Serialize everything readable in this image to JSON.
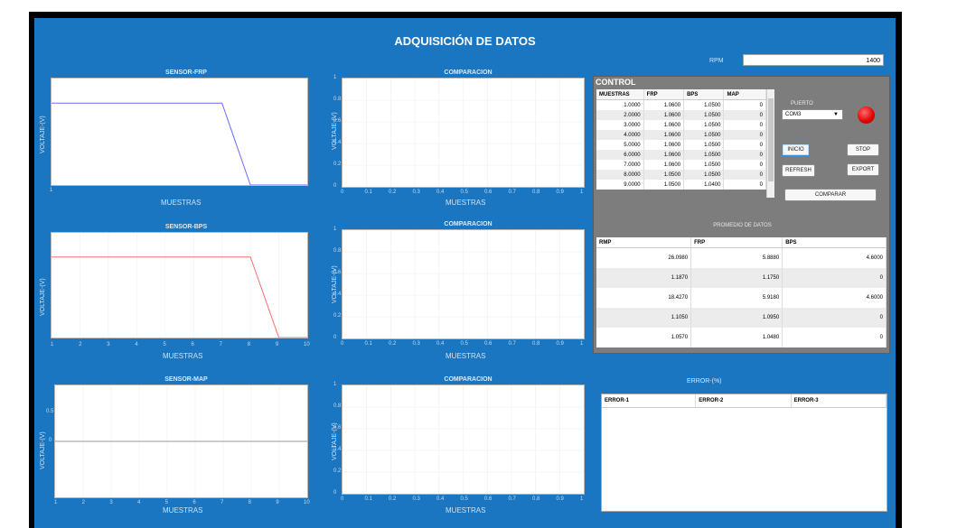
{
  "app": {
    "title": "ADQUISICIÓN DE DATOS",
    "rpm_label": "RPM",
    "rpm_value": "1400"
  },
  "plots": {
    "frp": {
      "title": "SENSOR-FRP",
      "xlabel": "MUESTRAS",
      "ylabel": "VOLTAJE-(V)",
      "xticks": [
        "1"
      ]
    },
    "bps": {
      "title": "SENSOR-BPS",
      "xlabel": "MUESTRAS",
      "ylabel": "VOLTAJE-(V)",
      "xticks": [
        "1",
        "2",
        "3",
        "4",
        "5",
        "6",
        "7",
        "8",
        "9",
        "10"
      ]
    },
    "map": {
      "title": "SENSOR-MAP",
      "xlabel": "MUESTRAS",
      "ylabel": "VOLTAJE-(V)",
      "xticks": [
        "1",
        "2",
        "3",
        "4",
        "5",
        "6",
        "7",
        "8",
        "9",
        "10"
      ],
      "yticks": [
        "0.5",
        "0"
      ]
    },
    "cmp1": {
      "title": "COMPARACION",
      "xlabel": "MUESTRAS",
      "ylabel": "VOLTAJE-(V)"
    },
    "cmp2": {
      "title": "COMPARACION",
      "xlabel": "MUESTRAS",
      "ylabel": "VOLTAJE-(V)"
    },
    "cmp3": {
      "title": "COMPARACION",
      "xlabel": "MUESTRAS",
      "ylabel": "VOLTAJE-(V)"
    },
    "cmp_xticks": [
      "0",
      "0.1",
      "0.2",
      "0.3",
      "0.4",
      "0.5",
      "0.6",
      "0.7",
      "0.8",
      "0.9",
      "1"
    ],
    "cmp_yticks": [
      "1",
      "0.8",
      "0.6",
      "0.4",
      "0.2",
      "0"
    ]
  },
  "control": {
    "title": "CONTROL",
    "samples": {
      "headers": [
        "MUESTRAS",
        "FRP",
        "BPS",
        "MAP"
      ],
      "rows": [
        [
          "1.0000",
          "1.0600",
          "1.0500",
          "0"
        ],
        [
          "2.0000",
          "1.0600",
          "1.0500",
          "0"
        ],
        [
          "3.0000",
          "1.0600",
          "1.0500",
          "0"
        ],
        [
          "4.0000",
          "1.0600",
          "1.0500",
          "0"
        ],
        [
          "5.0000",
          "1.0600",
          "1.0500",
          "0"
        ],
        [
          "6.0000",
          "1.0600",
          "1.0500",
          "0"
        ],
        [
          "7.0000",
          "1.0600",
          "1.0500",
          "0"
        ],
        [
          "8.0000",
          "1.0500",
          "1.0500",
          "0"
        ],
        [
          "9.0000",
          "1.0500",
          "1.0400",
          "0"
        ]
      ]
    },
    "puerto_label": "PUERTO",
    "puerto_value": "COM3",
    "buttons": {
      "inicio": "INICIO",
      "stop": "STOP",
      "refresh": "REFRESH",
      "export": "EXPORT",
      "comparar": "COMPARAR"
    },
    "avg_title": "PROMEDIO DE DATOS",
    "avg": {
      "headers": [
        "RMP",
        "FRP",
        "BPS"
      ],
      "rows": [
        [
          "26.0980",
          "5.8880",
          "4.6000"
        ],
        [
          "1.1870",
          "1.1750",
          "0"
        ],
        [
          "18.4270",
          "5.9180",
          "4.6000"
        ],
        [
          "1.1050",
          "1.0950",
          "0"
        ],
        [
          "1.0570",
          "1.0480",
          "0"
        ]
      ]
    }
  },
  "error": {
    "title": "ERROR-(%)",
    "headers": [
      "ERROR-1",
      "ERROR-2",
      "ERROR-3"
    ]
  },
  "colors": {
    "frp_line": "#6b6bff",
    "bps_line": "#ff6b6b",
    "map_line": "#9a9a9a",
    "background": "#1a76c0"
  },
  "plot_series": {
    "frp": {
      "x": [
        1,
        7,
        8,
        10
      ],
      "y": [
        1.0,
        1.0,
        0,
        0
      ],
      "xlim": [
        1,
        10
      ],
      "ylim": [
        0,
        1.3
      ]
    },
    "bps": {
      "x": [
        1,
        8,
        9,
        10
      ],
      "y": [
        1.0,
        1.0,
        0,
        0
      ],
      "xlim": [
        1,
        10
      ],
      "ylim": [
        0,
        1.3
      ]
    },
    "map": {
      "x": [
        1,
        10
      ],
      "y": [
        0,
        0
      ],
      "xlim": [
        1,
        10
      ],
      "ylim": [
        -1,
        1
      ]
    }
  }
}
